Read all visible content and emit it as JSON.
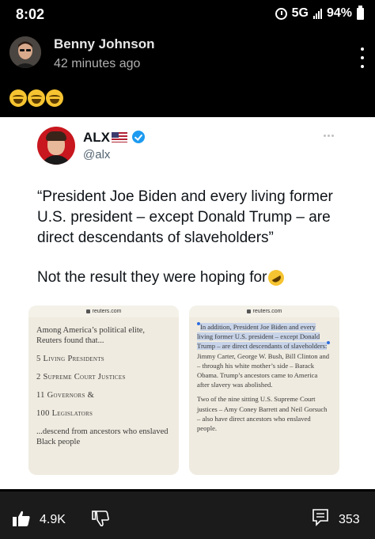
{
  "status_bar": {
    "time": "8:02",
    "network": "5G",
    "battery": "94%"
  },
  "post": {
    "author": "Benny Johnson",
    "time_ago": "42 minutes ago",
    "reaction_emojis": [
      "laugh-emoji",
      "laugh-emoji",
      "laugh-emoji"
    ]
  },
  "tweet": {
    "name": "ALX",
    "handle": "@alx",
    "quote": "“President Joe Biden and every living former U.S. president – except Donald Trump – are direct descendants of slaveholders”",
    "comment": "Not the result they were hoping for",
    "left_shot": {
      "url": "reuters.com",
      "intro": "Among America’s political elite, Reuters found that...",
      "items": [
        "5 Living Presidents",
        "2 Supreme Court Justices",
        "11 Governors &",
        "100 Legislators"
      ],
      "outro": "...descend from ancestors who enslaved Black people"
    },
    "right_shot": {
      "url": "reuters.com",
      "para1_highlighted": "In addition, President Joe Biden and every living former U.S. president – except Donald Trump – are direct descendants of slaveholders:",
      "para1_rest": " Jimmy Carter, George W. Bush, Bill Clinton and – through his white mother’s side – Barack Obama. Trump’s ancestors came to America after slavery was abolished.",
      "para2": "Two of the nine sitting U.S. Supreme Court justices – Amy Coney Barrett and Neil Gorsuch – also have direct ancestors who enslaved people."
    }
  },
  "actions": {
    "likes": "4.9K",
    "comments": "353"
  },
  "colors": {
    "background": "#000000",
    "card": "#ffffff",
    "verified": "#1d9bf0",
    "highlight": "#c7d3e8",
    "bottom_bar": "#1b1b1b"
  }
}
